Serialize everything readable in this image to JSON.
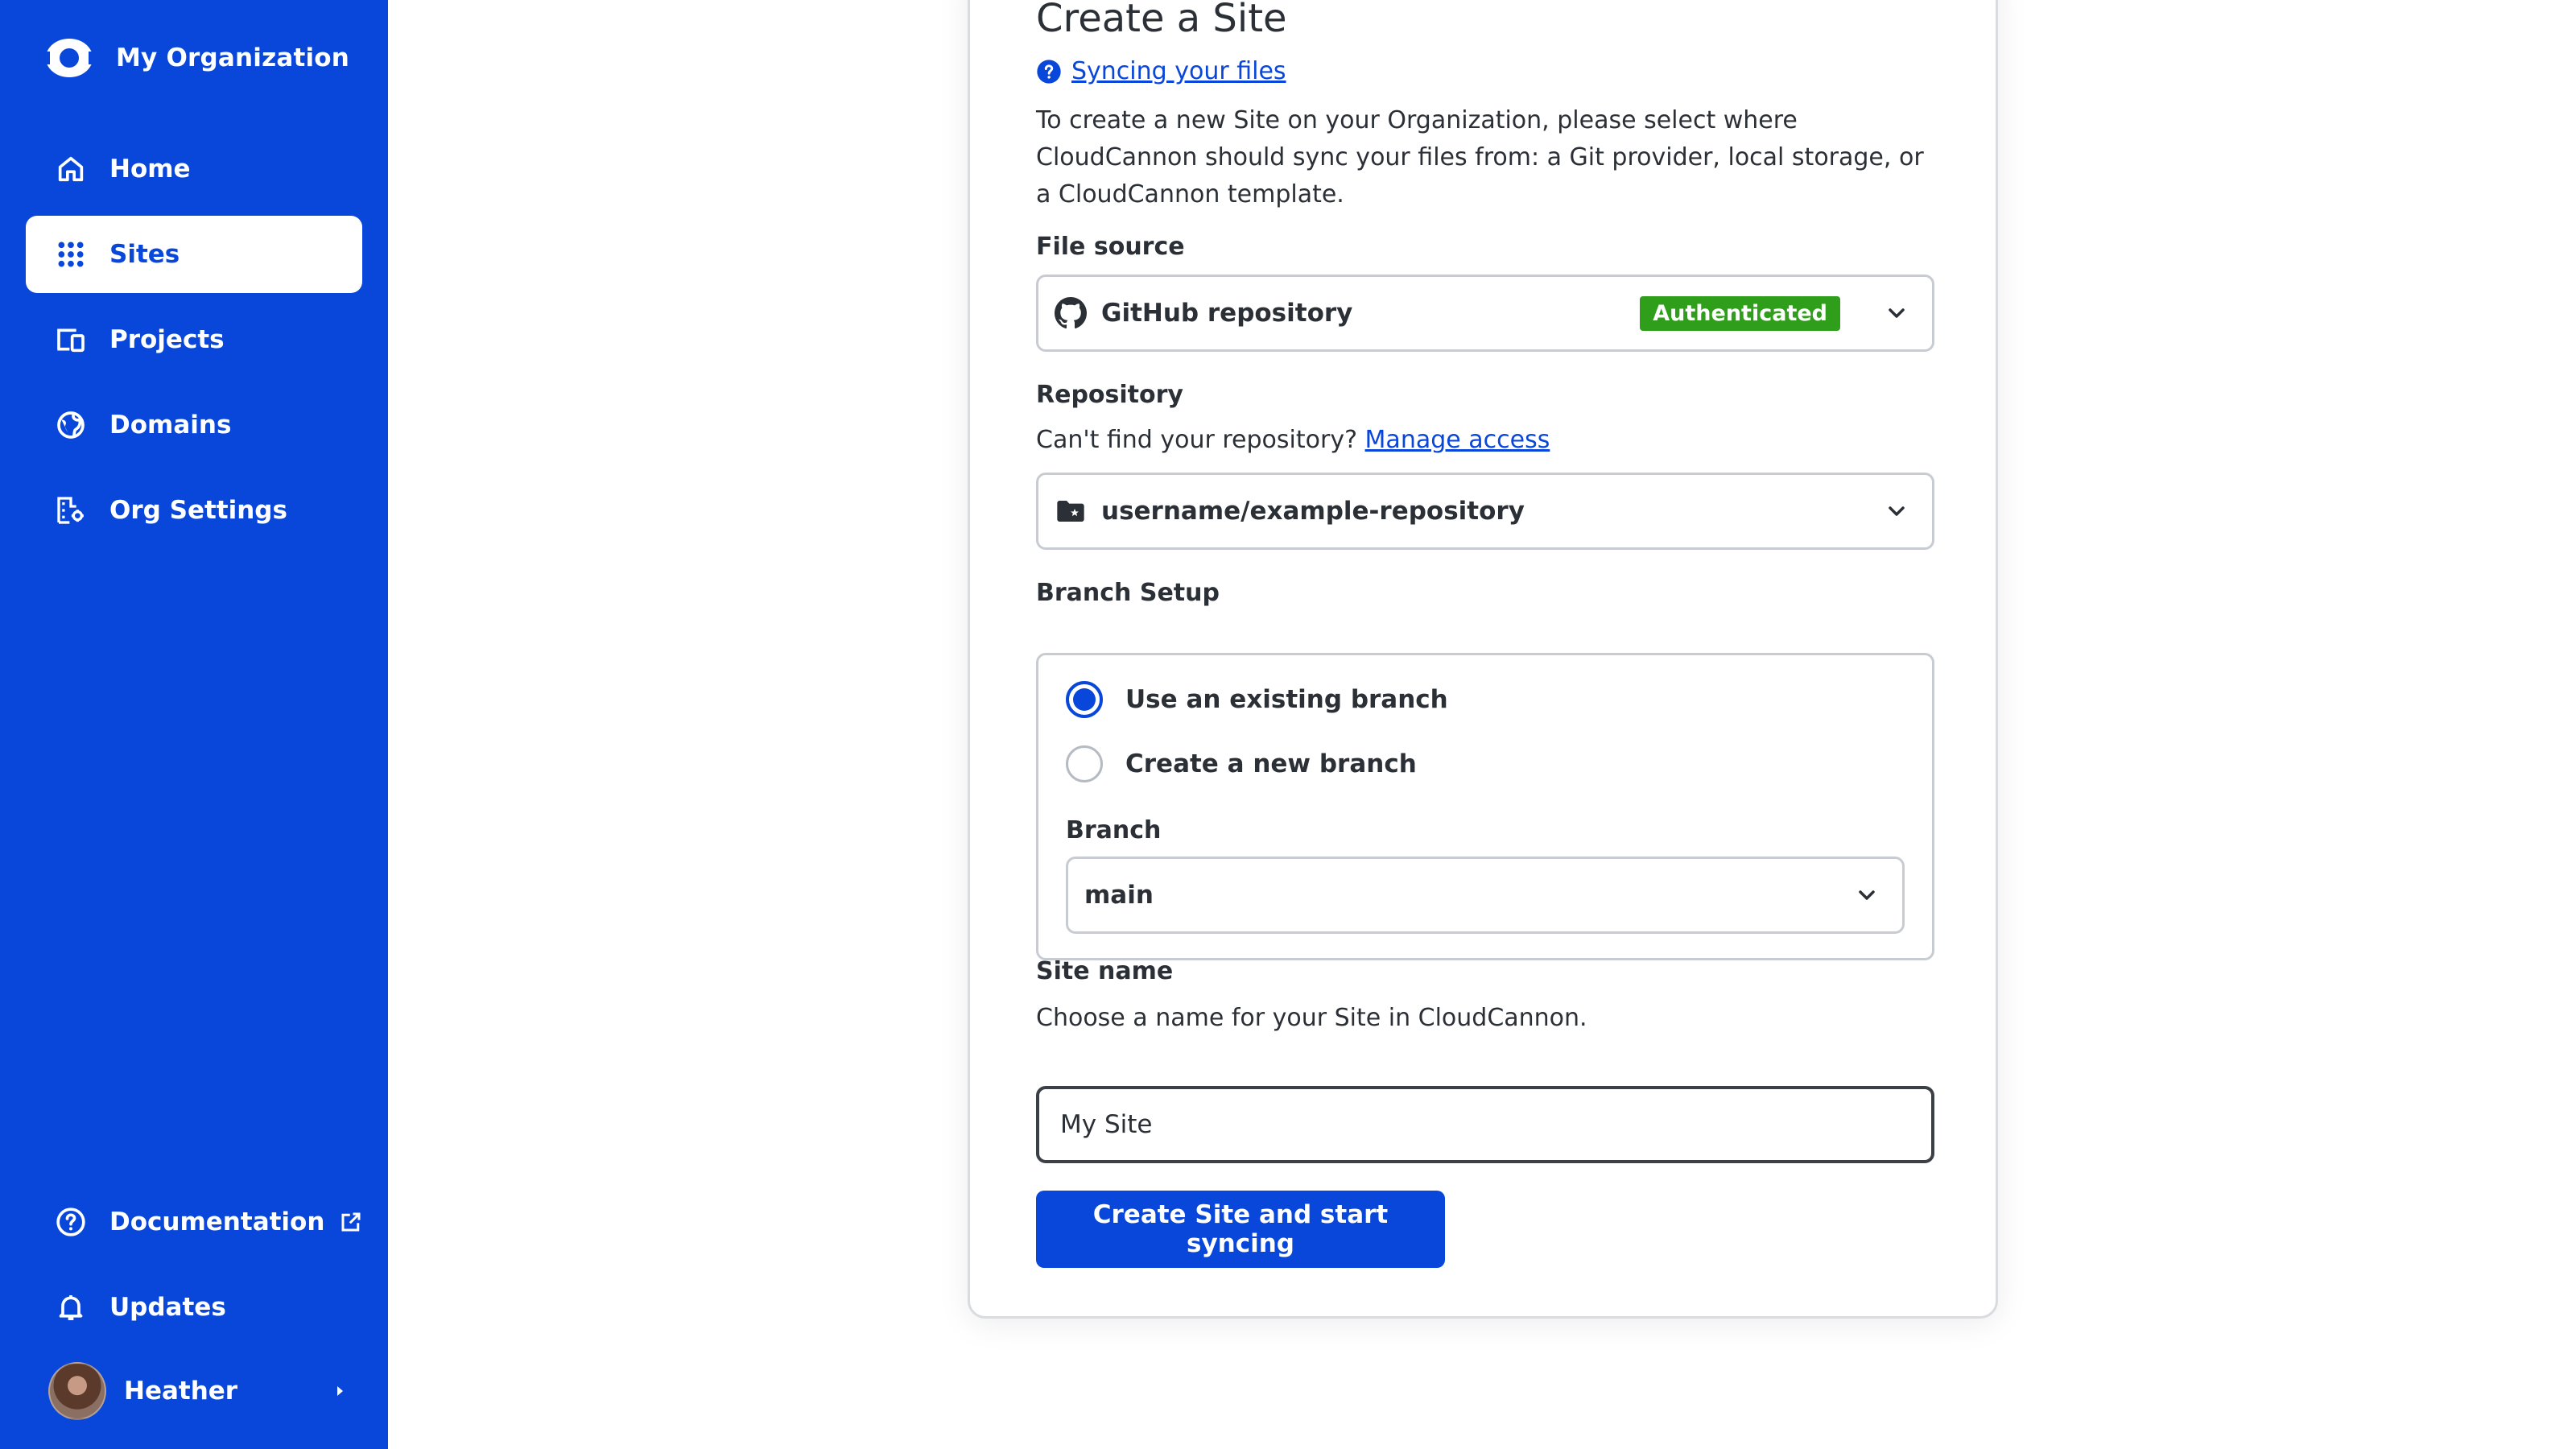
{
  "sidebar": {
    "org_name": "My Organization",
    "items": [
      {
        "label": "Home",
        "icon": "home-icon",
        "active": false
      },
      {
        "label": "Sites",
        "icon": "grid-icon",
        "active": true
      },
      {
        "label": "Projects",
        "icon": "devices-icon",
        "active": false
      },
      {
        "label": "Domains",
        "icon": "globe-icon",
        "active": false
      },
      {
        "label": "Org Settings",
        "icon": "building-settings-icon",
        "active": false
      }
    ],
    "bottom_items": [
      {
        "label": "Documentation",
        "icon": "help-circle-icon",
        "external": true
      },
      {
        "label": "Updates",
        "icon": "bell-icon"
      }
    ],
    "user": {
      "name": "Heather"
    }
  },
  "form": {
    "title": "Create a Site",
    "help_link": "Syncing your files",
    "intro": "To create a new Site on your Organization, please select where CloudCannon should sync your files from: a Git provider, local storage, or a CloudCannon template.",
    "file_source": {
      "label": "File source",
      "value": "GitHub repository",
      "badge": "Authenticated",
      "badge_color": "#2f9e1a"
    },
    "repository": {
      "label": "Repository",
      "hint": "Can't find your repository?",
      "hint_link": "Manage access",
      "value": "username/example-repository"
    },
    "branch_setup": {
      "label": "Branch Setup",
      "options": [
        {
          "label": "Use an existing branch",
          "selected": true
        },
        {
          "label": "Create a new branch",
          "selected": false
        }
      ],
      "branch_label": "Branch",
      "branch_value": "main"
    },
    "site_name": {
      "label": "Site name",
      "hint": "Choose a name for your Site in CloudCannon.",
      "value": "My Site"
    },
    "submit_label": "Create Site and start syncing"
  },
  "colors": {
    "accent": "#0847da",
    "success": "#2f9e1a"
  }
}
